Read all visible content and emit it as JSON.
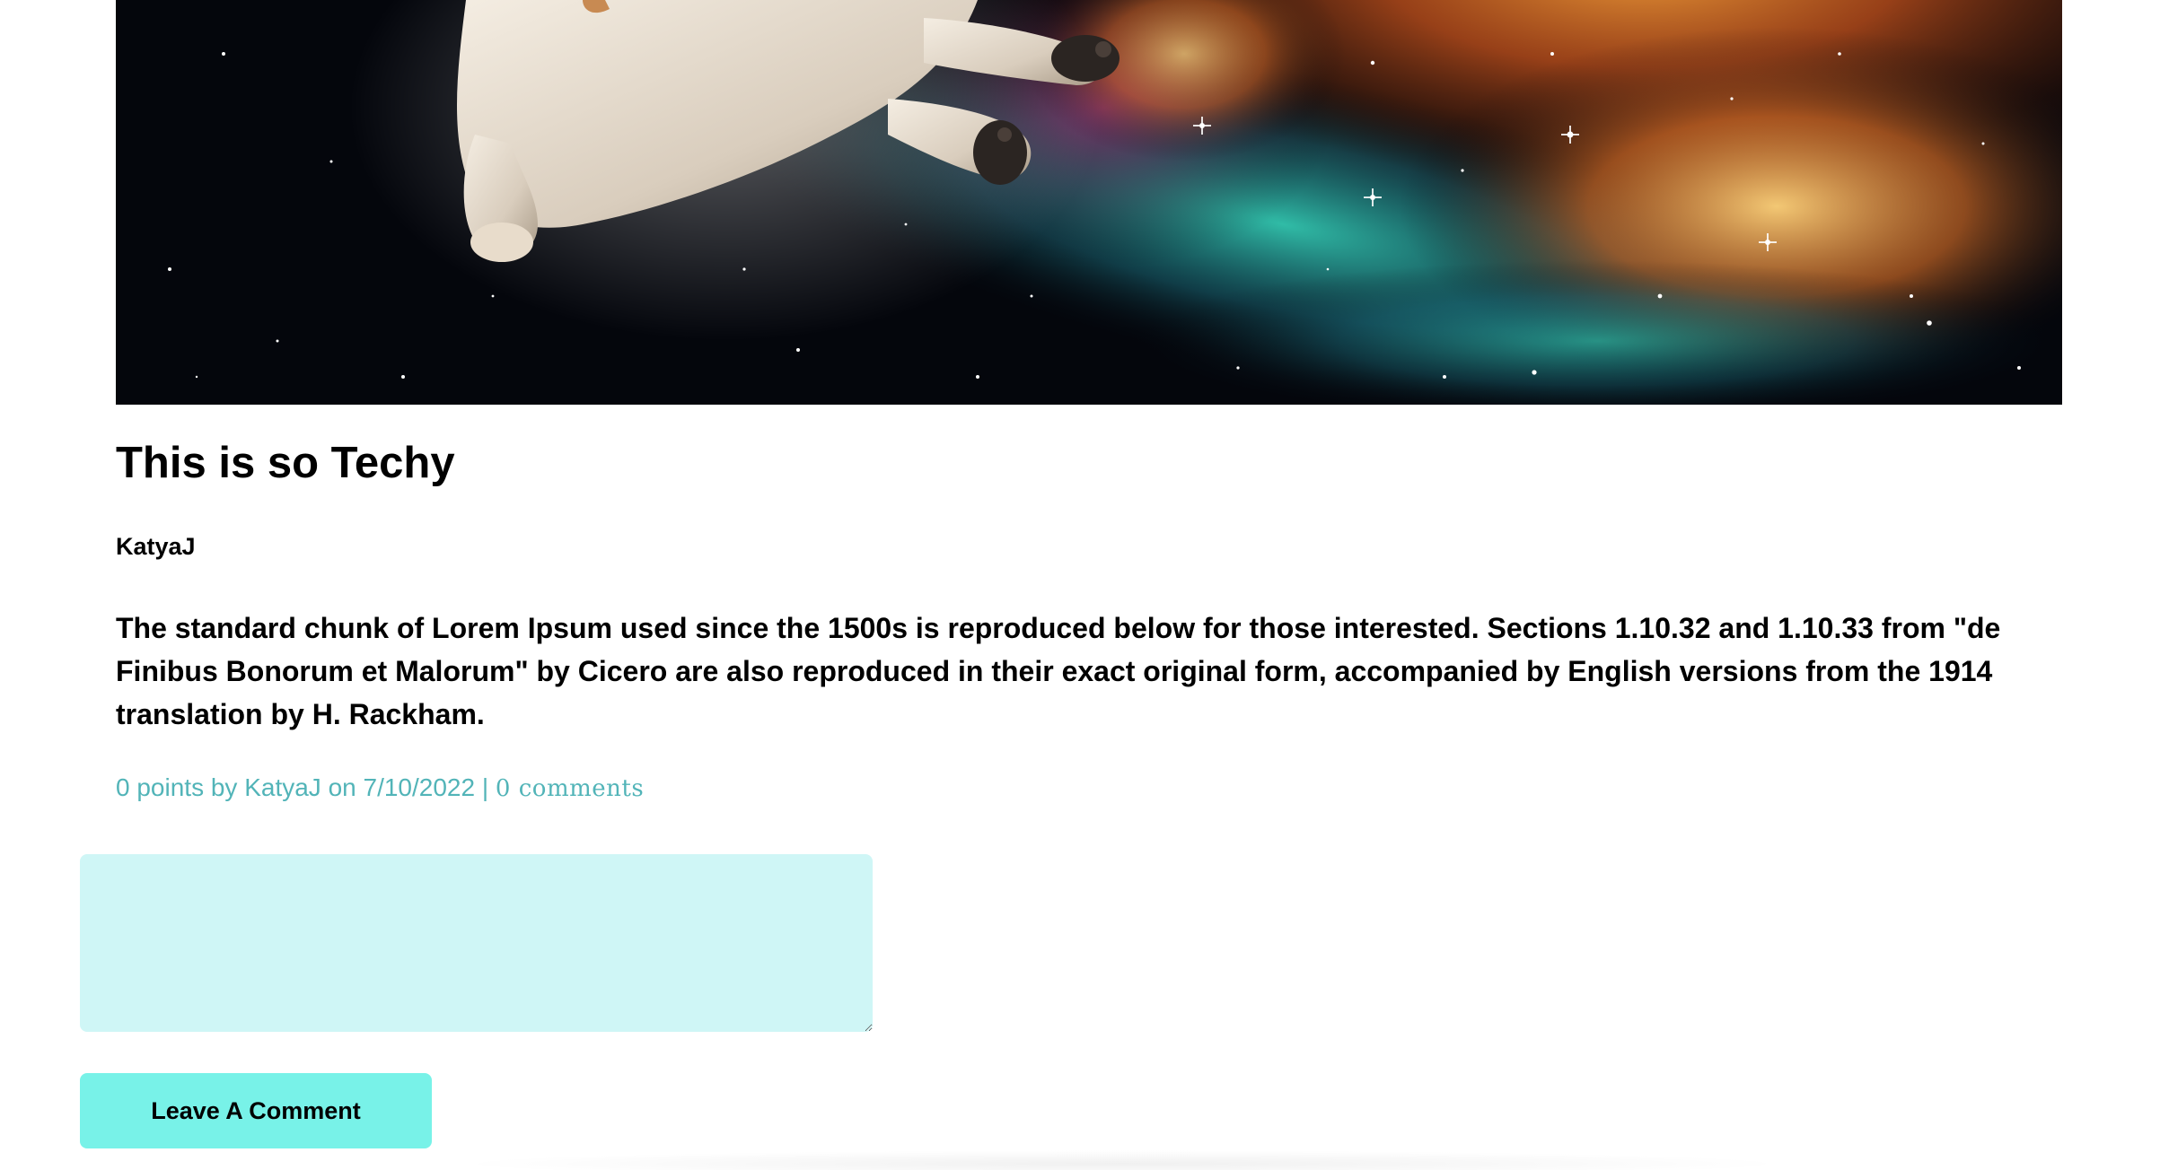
{
  "hero": {
    "alt": "Dog floating in a colorful space nebula"
  },
  "post": {
    "title": "This is so Techy",
    "author": "KatyaJ",
    "body": "The standard chunk of Lorem Ipsum used since the 1500s is reproduced below for those interested. Sections 1.10.32 and 1.10.33 from \"de Finibus Bonorum et Malorum\" by Cicero are also reproduced in their exact original form, accompanied by English versions from the 1914 translation by H. Rackham.",
    "meta": {
      "points_text": "0 points by KatyaJ on 7/10/2022",
      "separator": "|",
      "comments_link": "0 comments"
    }
  },
  "comment_form": {
    "textarea_value": "",
    "button_label": "Leave A Comment"
  },
  "colors": {
    "meta_text": "#52b4b8",
    "textarea_bg": "#cff6f6",
    "button_bg": "#78f2e8"
  }
}
